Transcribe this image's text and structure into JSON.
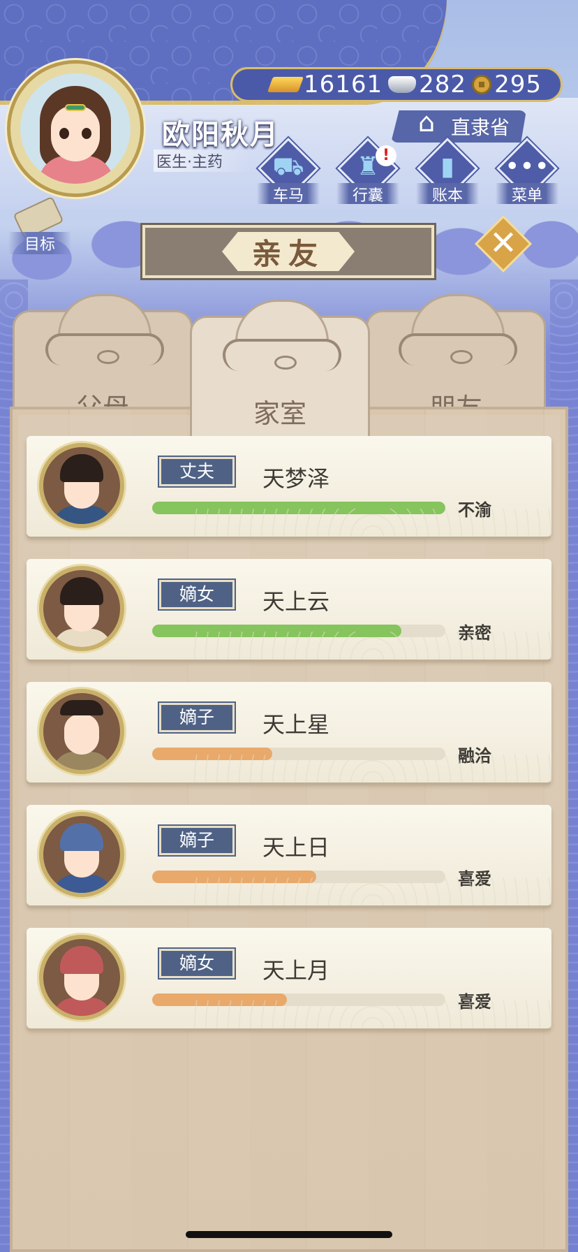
{
  "player": {
    "name": "欧阳秋月",
    "role": "医生·主药"
  },
  "currency": {
    "gold": "16161",
    "silver": "282",
    "coins": "295"
  },
  "location": "直隶省",
  "menu": [
    {
      "label": "车马",
      "icon": "carriage-icon",
      "alert": false
    },
    {
      "label": "行囊",
      "icon": "bag-icon",
      "alert": true
    },
    {
      "label": "账本",
      "icon": "ledger-icon",
      "alert": false
    },
    {
      "label": "菜单",
      "icon": "more-icon",
      "alert": false
    }
  ],
  "alert_mark": "!",
  "goal_label": "目标",
  "panel_title": "亲友",
  "tabs": [
    {
      "label": "父母",
      "active": false
    },
    {
      "label": "家室",
      "active": true
    },
    {
      "label": "朋友",
      "active": false
    }
  ],
  "members": [
    {
      "relation": "丈夫",
      "name": "天梦泽",
      "status": "不渝",
      "affinity": 1.0,
      "bar_color": "#86c45d"
    },
    {
      "relation": "嫡女",
      "name": "天上云",
      "status": "亲密",
      "affinity": 0.85,
      "bar_color": "#86c45d"
    },
    {
      "relation": "嫡子",
      "name": "天上星",
      "status": "融洽",
      "affinity": 0.41,
      "bar_color": "#e8a96a"
    },
    {
      "relation": "嫡子",
      "name": "天上日",
      "status": "喜爱",
      "affinity": 0.56,
      "bar_color": "#e8a96a"
    },
    {
      "relation": "嫡女",
      "name": "天上月",
      "status": "喜爱",
      "affinity": 0.46,
      "bar_color": "#e8a96a"
    }
  ]
}
